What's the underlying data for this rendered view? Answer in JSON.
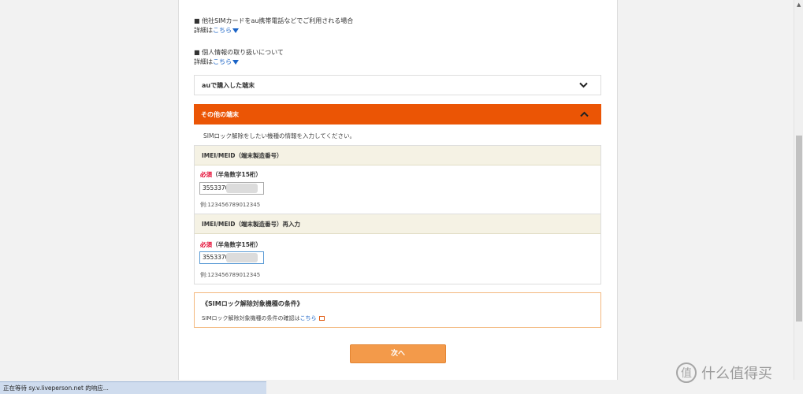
{
  "notices": [
    {
      "title": "■ 他社SIMカードをau携帯電話などでご利用される場合",
      "detail_prefix": "詳細は",
      "detail_link": "こちら"
    },
    {
      "title": "■ 個人情報の取り扱いについて",
      "detail_prefix": "詳細は",
      "detail_link": "こちら"
    }
  ],
  "accordion": {
    "au_device": {
      "label": "auで購入した端末",
      "state": "collapsed"
    },
    "other_device": {
      "label": "その他の端末",
      "state": "expanded"
    }
  },
  "form": {
    "intro": "SIMロック解除をしたい機種の情報を入力してください。",
    "imei": {
      "header": "IMEI/MEID（端末製造番号）",
      "required_label": "必須",
      "required_hint": "（半角数字15桁）",
      "value": "3553370",
      "example": "例:123456789012345"
    },
    "imei_confirm": {
      "header": "IMEI/MEID（端末製造番号）再入力",
      "required_label": "必須",
      "required_hint": "（半角数字15桁）",
      "value": "3553370",
      "example": "例:123456789012345"
    }
  },
  "conditions": {
    "title": "《SIMロック解除対象機種の条件》",
    "text_prefix": "SIMロック解除対象機種の条件の確認は",
    "link": "こちら"
  },
  "next_button": "次へ",
  "status_bar": "正在等待 sy.v.liveperson.net 的响应...",
  "watermark": {
    "badge": "值",
    "text": "什么值得买"
  },
  "colors": {
    "accent": "#eb5505",
    "link": "#1a63c6",
    "required": "#e4002b",
    "button": "#f39a4a"
  }
}
